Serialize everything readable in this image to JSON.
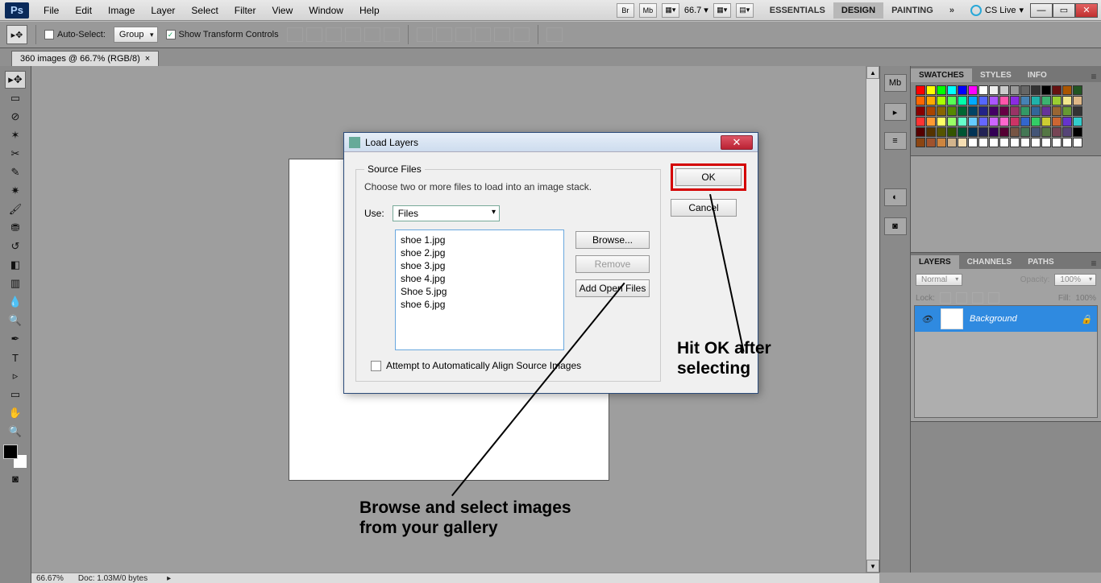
{
  "app": {
    "logo": "Ps"
  },
  "menu": [
    "File",
    "Edit",
    "Image",
    "Layer",
    "Select",
    "Filter",
    "View",
    "Window",
    "Help"
  ],
  "topZoom": "66.7",
  "workspaces": [
    "ESSENTIALS",
    "DESIGN",
    "PAINTING"
  ],
  "cslive": "CS Live",
  "options": {
    "autoSelectLabel": "Auto-Select:",
    "autoSelectValue": "Group",
    "showTransform": "Show Transform Controls"
  },
  "doc": {
    "tab": "360 images @ 66.7% (RGB/8)",
    "close": "×"
  },
  "panels": {
    "swatchesTabs": [
      "SWATCHES",
      "STYLES",
      "INFO"
    ],
    "layersTabs": [
      "LAYERS",
      "CHANNELS",
      "PATHS"
    ],
    "blendMode": "Normal",
    "opacityLabel": "Opacity:",
    "opacityVal": "100%",
    "lockLabel": "Lock:",
    "fillLabel": "Fill:",
    "fillVal": "100%",
    "layerName": "Background"
  },
  "dialog": {
    "title": "Load Layers",
    "fieldset": "Source Files",
    "help": "Choose two or more files to load into an image stack.",
    "useLabel": "Use:",
    "useValue": "Files",
    "files": [
      "shoe 1.jpg",
      "shoe 2.jpg",
      "shoe 3.jpg",
      "shoe 4.jpg",
      "Shoe 5.jpg",
      "shoe 6.jpg"
    ],
    "browse": "Browse...",
    "remove": "Remove",
    "addOpen": "Add Open Files",
    "attempt": "Attempt to Automatically Align Source Images",
    "ok": "OK",
    "cancel": "Cancel"
  },
  "annotations": {
    "a1l1": "Hit OK after",
    "a1l2": "selecting",
    "a2l1": "Browse and select images",
    "a2l2": "from your gallery"
  },
  "status": {
    "zoom": "66.67%",
    "doc": "Doc: 1.03M/0 bytes"
  },
  "swatchColors": [
    "#ff0000",
    "#ffff00",
    "#00ff00",
    "#00ffff",
    "#0000ff",
    "#ff00ff",
    "#ffffff",
    "#eeeeee",
    "#cccccc",
    "#999999",
    "#666666",
    "#333333",
    "#000000",
    "#661111",
    "#aa5500",
    "#225522",
    "#ff6600",
    "#ffaa00",
    "#aaff00",
    "#55ff55",
    "#00ffaa",
    "#00aaff",
    "#5566ff",
    "#aa55ff",
    "#ff55aa",
    "#8a2be2",
    "#4682b4",
    "#20b2aa",
    "#3cb371",
    "#9acd32",
    "#f0e68c",
    "#deb887",
    "#880000",
    "#aa4400",
    "#886600",
    "#558800",
    "#006633",
    "#004466",
    "#222288",
    "#440066",
    "#660044",
    "#993366",
    "#339966",
    "#336699",
    "#663399",
    "#996633",
    "#669933",
    "#333",
    "#ff3333",
    "#ff9933",
    "#ffff66",
    "#99ff66",
    "#66ffcc",
    "#66ccff",
    "#6666ff",
    "#cc66ff",
    "#ff66cc",
    "#cc3366",
    "#3366cc",
    "#33cc66",
    "#cccc33",
    "#cc6633",
    "#6633cc",
    "#33cccc",
    "#550000",
    "#553300",
    "#555500",
    "#335500",
    "#005533",
    "#003355",
    "#222255",
    "#330055",
    "#550033",
    "#775544",
    "#447755",
    "#445577",
    "#557744",
    "#774455",
    "#554477",
    "#000",
    "#8b4513",
    "#a0522d",
    "#cd853f",
    "#d2b48c",
    "#f5deb3",
    "#fff",
    "#fff",
    "#fff",
    "#fff",
    "#fff",
    "#fff",
    "#fff",
    "#fff",
    "#fff",
    "#fff",
    "#fff"
  ]
}
